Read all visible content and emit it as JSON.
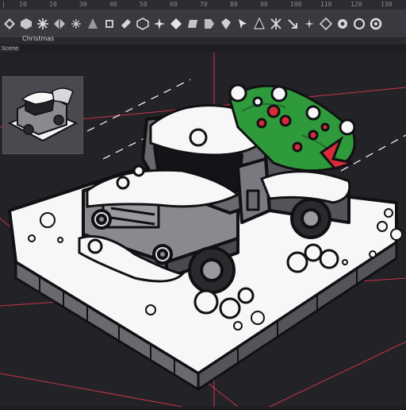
{
  "ruler": {
    "ticks": [
      "|",
      "10",
      "20",
      "30",
      "40",
      "50",
      "60",
      "70",
      "80",
      "90",
      "100",
      "110",
      "120",
      "130"
    ]
  },
  "toolbar": {
    "tools": [
      {
        "icon": "diamond-grid-icon"
      },
      {
        "icon": "cube-icon"
      },
      {
        "icon": "snowflake-icon"
      },
      {
        "icon": "diamond-split-icon"
      },
      {
        "icon": "snowflake-small-icon"
      },
      {
        "icon": "tree-icon"
      },
      {
        "icon": "square-stack-icon"
      },
      {
        "icon": "tilt-square-icon"
      },
      {
        "icon": "cube-outline-icon"
      },
      {
        "icon": "star-burst-icon"
      },
      {
        "icon": "diamond-fill-icon"
      },
      {
        "icon": "rhombus-icon"
      },
      {
        "icon": "tag-icon"
      },
      {
        "icon": "crystal-icon"
      },
      {
        "icon": "pointer-icon"
      },
      {
        "icon": "tree-dark-icon"
      },
      {
        "icon": "cross-star-icon"
      },
      {
        "icon": "arrow-down-right-icon"
      },
      {
        "icon": "sparkle-icon"
      },
      {
        "icon": "diamond-outline-icon"
      },
      {
        "icon": "circle-target-icon"
      },
      {
        "icon": "ring-icon"
      },
      {
        "icon": "ring-alt-icon"
      }
    ]
  },
  "label": "Christmas",
  "tab": "Scene",
  "colors": {
    "snow": "#f7f7f8",
    "truck": "#6a6970",
    "outline": "#111114",
    "ruler_red": "#c8354a",
    "holly": "#2f9a3b",
    "berry": "#d92a3a"
  }
}
